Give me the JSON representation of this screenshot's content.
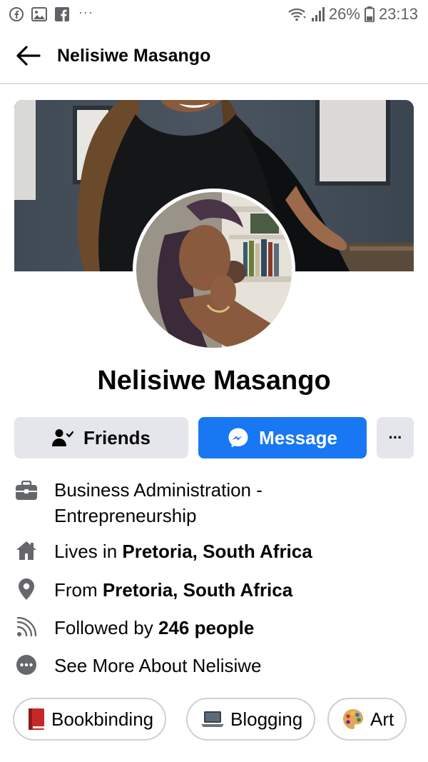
{
  "status_bar": {
    "battery": "26%",
    "time": "23:13",
    "icons": [
      "facebook-icon",
      "gallery-icon",
      "facebook-square-icon",
      "more-dots-icon",
      "wifi-icon",
      "signal-icon",
      "battery-icon"
    ]
  },
  "header": {
    "title": "Nelisiwe Masango",
    "back_icon": "arrow-left-icon"
  },
  "profile": {
    "name": "Nelisiwe Masango"
  },
  "actions": {
    "friends_label": "Friends",
    "message_label": "Message",
    "more_label": "···"
  },
  "details": {
    "work_line1": "Business Administration -",
    "work_line2": "Entrepreneurship",
    "lives_prefix": "Lives in ",
    "lives_place": "Pretoria, South Africa",
    "from_prefix": "From ",
    "from_place": "Pretoria, South Africa",
    "followed_prefix": "Followed by ",
    "followed_count": "246 people",
    "see_more": "See More About Nelisiwe"
  },
  "interests": [
    {
      "label": "Bookbinding",
      "icon": "red-book-icon"
    },
    {
      "label": "Blogging",
      "icon": "laptop-icon"
    },
    {
      "label": "Art",
      "icon": "artist-palette-icon"
    }
  ],
  "colors": {
    "accent": "#1877f2",
    "button_gray": "#e4e6eb",
    "icon_gray": "#65676b"
  }
}
